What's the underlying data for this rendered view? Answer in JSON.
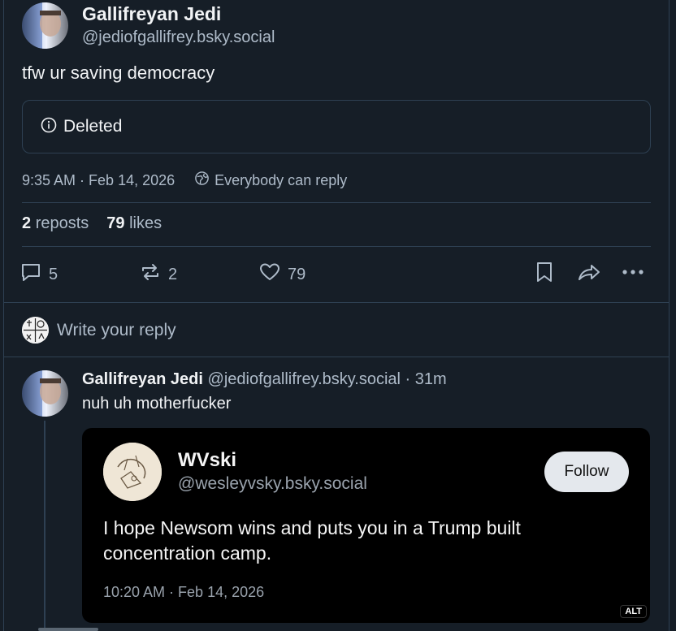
{
  "post": {
    "author_name": "Gallifreyan Jedi",
    "author_handle": "@jediofgallifrey.bsky.social",
    "text": "tfw ur saving democracy",
    "quote_status": "Deleted",
    "time": "9:35 AM",
    "date": "Feb 14, 2026",
    "reply_setting": "Everybody can reply",
    "reposts_count": "2",
    "reposts_label": "reposts",
    "likes_count": "79",
    "likes_label": "likes",
    "actions": {
      "reply_count": "5",
      "repost_count": "2",
      "like_count": "79"
    }
  },
  "composer": {
    "placeholder": "Write your reply"
  },
  "reply": {
    "author_name": "Gallifreyan Jedi",
    "author_handle": "@jediofgallifrey.bsky.social",
    "age": "31m",
    "text": "nuh uh motherfucker",
    "embed": {
      "author_name": "WVski",
      "author_handle": "@wesleyvsky.bsky.social",
      "follow_label": "Follow",
      "text": "I hope Newsom wins and puts you in a Trump built concentration camp.",
      "timestamp": "10:20 AM · Feb 14, 2026",
      "alt_badge": "ALT"
    }
  },
  "colors": {
    "background": "#161e27",
    "border": "#2e4052",
    "text_primary": "#f1f3f5",
    "text_secondary": "#aebbc9"
  },
  "icons": [
    "info-icon",
    "globe-icon",
    "comment-icon",
    "repost-icon",
    "heart-icon",
    "bookmark-icon",
    "share-icon",
    "more-icon"
  ]
}
